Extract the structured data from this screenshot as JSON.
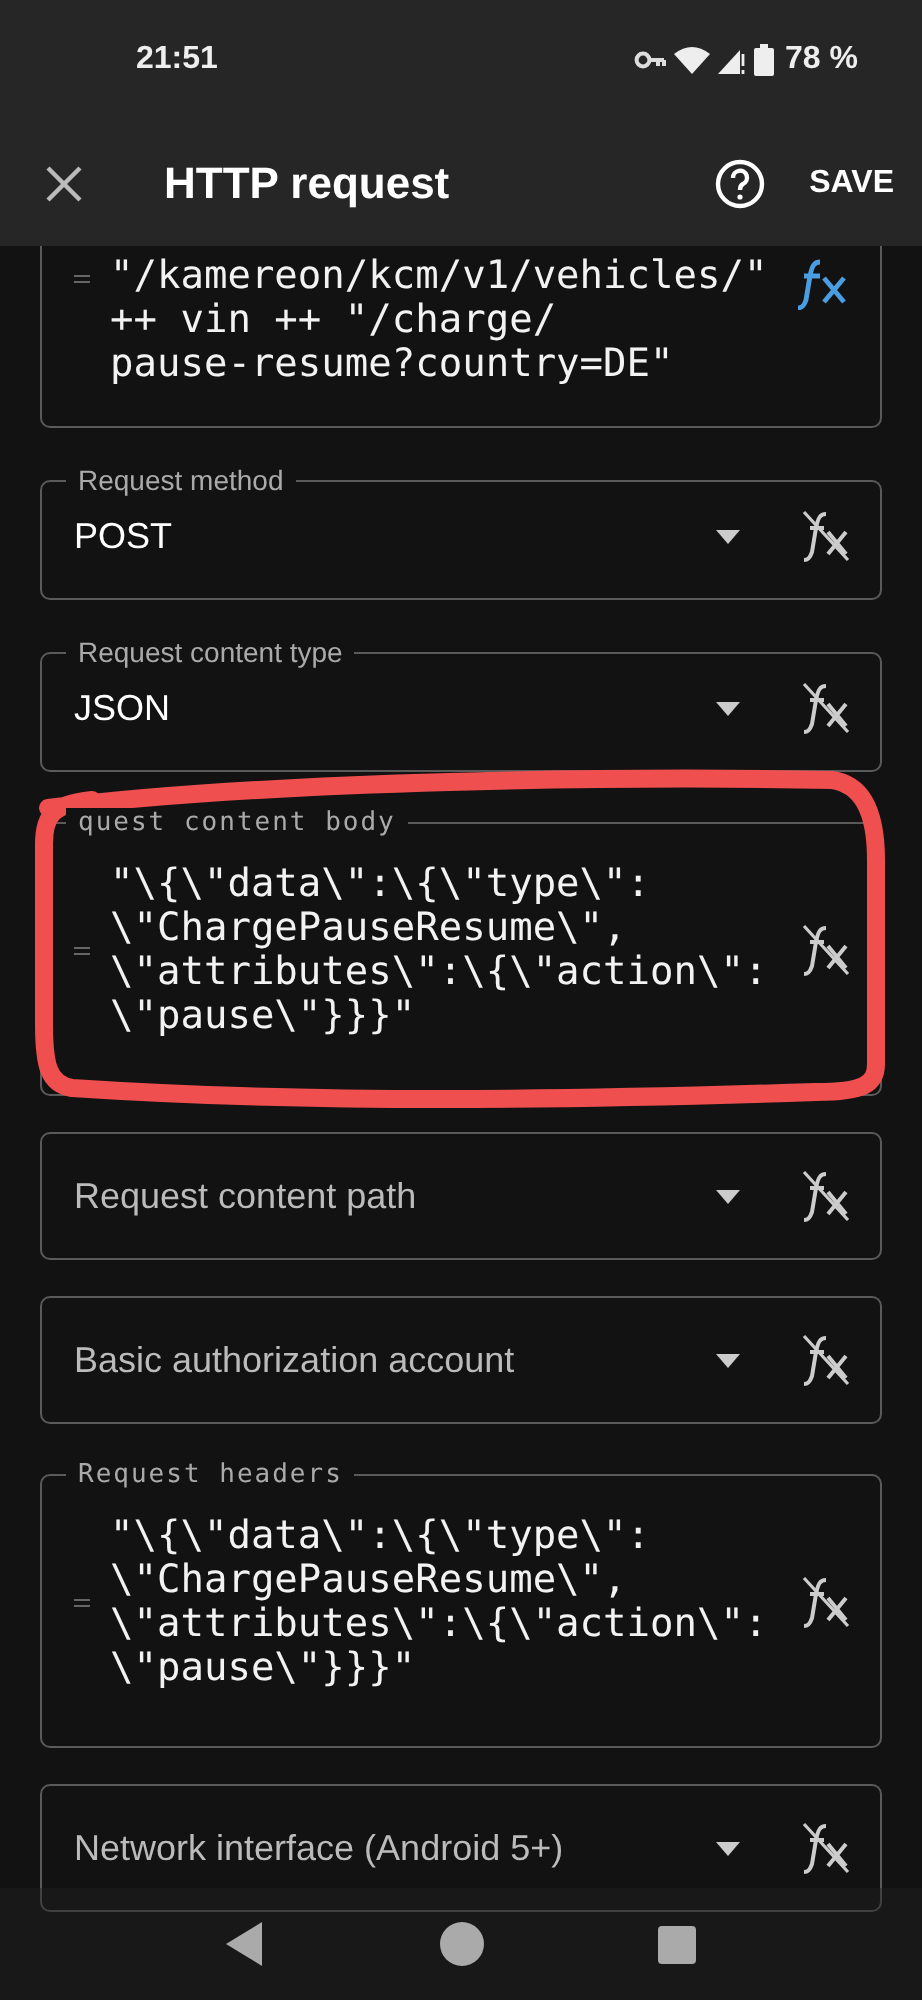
{
  "status_bar": {
    "time": "21:51",
    "battery": "78 %"
  },
  "app_bar": {
    "title": "HTTP request",
    "action": "SAVE"
  },
  "fields": [
    {
      "kind": "code",
      "lines": [
        "\"/kamereon/kcm/v1/vehicles/\"",
        "++ vin ++ \"/charge/",
        "pause-resume?country=DE\""
      ],
      "formula": true,
      "circled": false
    },
    {
      "kind": "dropdown",
      "label": "Request method",
      "value": "POST",
      "formula": false,
      "circled": false
    },
    {
      "kind": "dropdown",
      "label": "Request content type",
      "value": "JSON",
      "formula": false,
      "circled": false
    },
    {
      "kind": "code",
      "label": "quest content body",
      "lines": [
        "\"\\{\\\"data\\\":\\{\\\"type\\\":",
        "\\\"ChargePauseResume\\\",",
        "\\\"attributes\\\":\\{\\\"action\\\":",
        "\\\"pause\\\"}}}\""
      ],
      "formula": false,
      "circled": true
    },
    {
      "kind": "dropdown",
      "placeholder": "Request content path",
      "formula": false,
      "circled": false
    },
    {
      "kind": "dropdown",
      "placeholder": "Basic authorization account",
      "formula": false,
      "circled": false
    },
    {
      "kind": "code",
      "label": "Request headers",
      "lines": [
        "\"\\{\\\"data\\\":\\{\\\"type\\\":",
        "\\\"ChargePauseResume\\\",",
        "\\\"attributes\\\":\\{\\\"action\\\":",
        "\\\"pause\\\"}}}\""
      ],
      "formula": false,
      "circled": false
    },
    {
      "kind": "dropdown",
      "placeholder": "Network interface (Android 5+)",
      "formula": false,
      "circled": false
    }
  ]
}
